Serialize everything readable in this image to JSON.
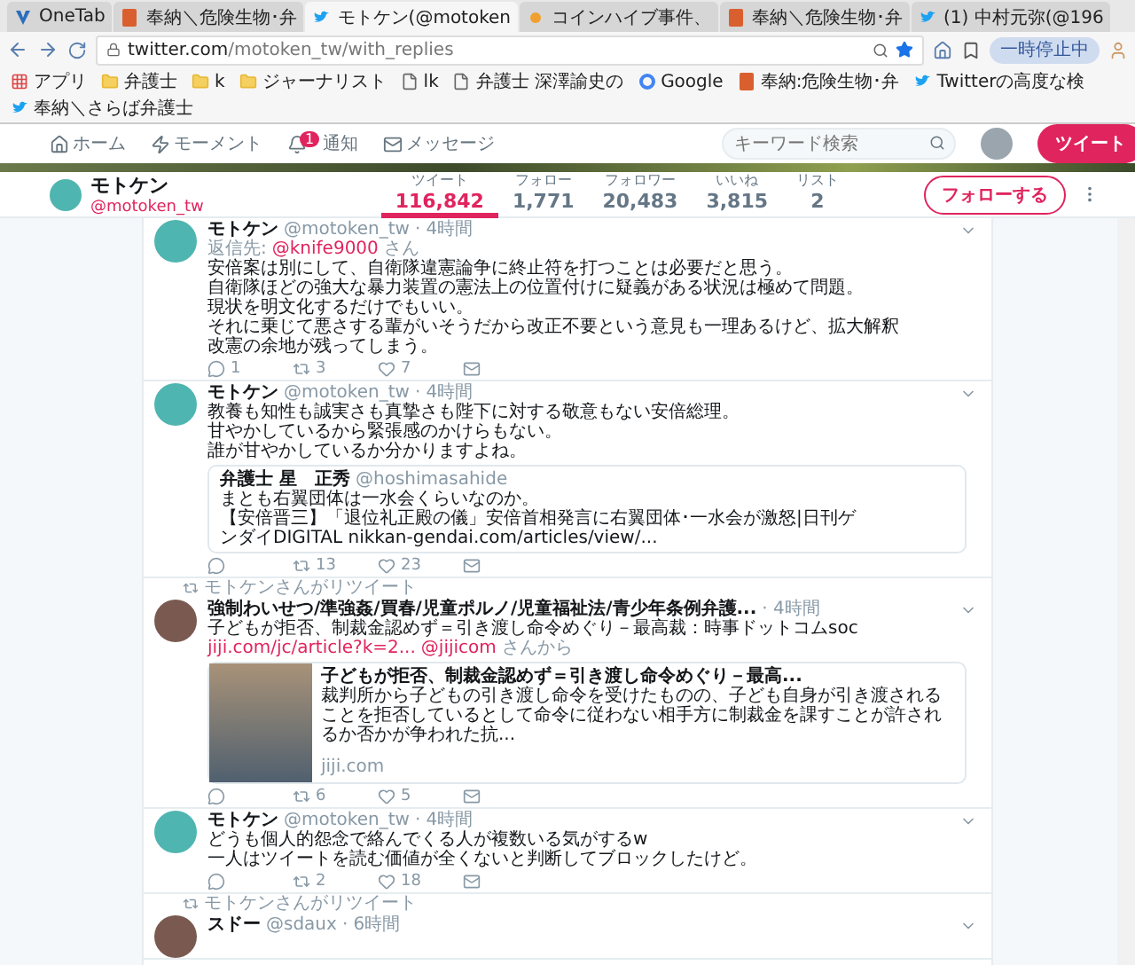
{
  "browser": {
    "tabs": [
      {
        "title": "OneTab",
        "kind": "v",
        "selected": false
      },
      {
        "title": "奉納＼危険生物･弁",
        "kind": "doc",
        "selected": false
      },
      {
        "title": "モトケン(@motoken",
        "kind": "bird",
        "selected": true
      },
      {
        "title": "コインハイブ事件、",
        "kind": "sun",
        "selected": false
      },
      {
        "title": "奉納＼危険生物･弁",
        "kind": "doc",
        "selected": false
      },
      {
        "title": "(1) 中村元弥(@196",
        "kind": "bird",
        "selected": false
      }
    ],
    "url": {
      "host": "twitter.com",
      "path": "/motoken_tw/with_replies"
    },
    "pause_button": "一時停止中",
    "bookmarks": [
      {
        "label": "アプリ",
        "kind": "apps"
      },
      {
        "label": "弁護士",
        "kind": "folder"
      },
      {
        "label": "k",
        "kind": "folder"
      },
      {
        "label": "ジャーナリスト",
        "kind": "folder"
      },
      {
        "label": "lk",
        "kind": "page"
      },
      {
        "label": "弁護士 深澤諭史の",
        "kind": "page"
      },
      {
        "label": "Google",
        "kind": "google"
      },
      {
        "label": "奉納:危険生物･弁",
        "kind": "doc"
      },
      {
        "label": "Twitterの高度な検",
        "kind": "bird"
      },
      {
        "label": "奉納＼さらば弁護士",
        "kind": "bird"
      }
    ]
  },
  "nav": {
    "items": [
      {
        "label": "ホーム",
        "kind": "home"
      },
      {
        "label": "モーメント",
        "kind": "moments"
      },
      {
        "label": "通知",
        "kind": "bell",
        "badge": "1"
      },
      {
        "label": "メッセージ",
        "kind": "mail"
      }
    ],
    "search": {
      "placeholder": "キーワード検索"
    },
    "tweet_button": "ツイート"
  },
  "profile": {
    "name": "モトケン",
    "handle": "@motoken_tw",
    "stats": [
      {
        "label": "ツイート",
        "value": "116,842",
        "selected": true
      },
      {
        "label": "フォロー",
        "value": "1,771",
        "selected": false
      },
      {
        "label": "フォロワー",
        "value": "20,483",
        "selected": false
      },
      {
        "label": "いいね",
        "value": "3,815",
        "selected": false
      },
      {
        "label": "リスト",
        "value": "2",
        "selected": false
      }
    ],
    "follow_button": "フォローする"
  },
  "tweets": [
    {
      "name": "モトケン",
      "handle": "@motoken_tw",
      "time": "· 4時間",
      "reply_label": "返信先:",
      "reply_to": "@knife9000",
      "reply_suffix": "さん",
      "lines": [
        "安倍案は別にして、自衛隊違憲論争に終止符を打つことは必要だと思う。",
        "自衛隊ほどの強大な暴力装置の憲法上の位置付けに疑義がある状況は極めて問題。",
        "現状を明文化するだけでもいい。",
        "それに乗じて悪さする輩がいそうだから改正不要という意見も一理あるけど、拡大解釈",
        "改憲の余地が残ってしまう。"
      ],
      "counts": {
        "replies": "1",
        "retweets": "3",
        "likes": "7"
      }
    },
    {
      "name": "モトケン",
      "handle": "@motoken_tw",
      "time": "· 4時間",
      "lines": [
        "教養も知性も誠実さも真摯さも陛下に対する敬意もない安倍総理。",
        "甘やかしているから緊張感のかけらもない。",
        "誰が甘やかしているか分かりますよね。"
      ],
      "quote": {
        "name": "弁護士 星　正秀",
        "handle": "@hoshimasahide",
        "lines": [
          "まとも右翼団体は一水会くらいなのか。",
          "【安倍晋三】「退位礼正殿の儀」安倍首相発言に右翼団体･一水会が激怒|日刊ゲ",
          "ンダイDIGITAL nikkan-gendai.com/articles/view/..."
        ]
      },
      "counts": {
        "retweets": "13",
        "likes": "23"
      }
    },
    {
      "retweeted_by": "モトケンさんがリツイート",
      "name": "強制わいせつ/準強姦/買春/児童ポルノ/児童福祉法/青少年条例弁護...",
      "time": "· 4時間",
      "lines": [
        "子どもが拒否、制裁金認めず＝引き渡し命令めぐり－最高裁：時事ドットコムsoc"
      ],
      "link": "jiji.com/jc/article?k=2...",
      "link_mention": "@jijicom",
      "link_suffix": "さんから",
      "card": {
        "title": "子どもが拒否、制裁金認めず＝引き渡し命令めぐり－最高...",
        "description": "裁判所から子どもの引き渡し命令を受けたものの、子ども自身が引き渡されることを拒否しているとして命令に従わない相手方に制裁金を課すことが許されるか否かが争われた抗...",
        "domain": "jiji.com"
      },
      "counts": {
        "retweets": "6",
        "likes": "5"
      }
    },
    {
      "name": "モトケン",
      "handle": "@motoken_tw",
      "time": "· 4時間",
      "lines": [
        "どうも個人的怨念で絡んでくる人が複数いる気がするw",
        "一人はツイートを読む価値が全くないと判断してブロックしたけど。"
      ],
      "counts": {
        "retweets": "2",
        "likes": "18"
      }
    },
    {
      "retweeted_by": "モトケンさんがリツイート",
      "name": "スドー",
      "handle": "@sdaux",
      "time": "· 6時間"
    }
  ]
}
